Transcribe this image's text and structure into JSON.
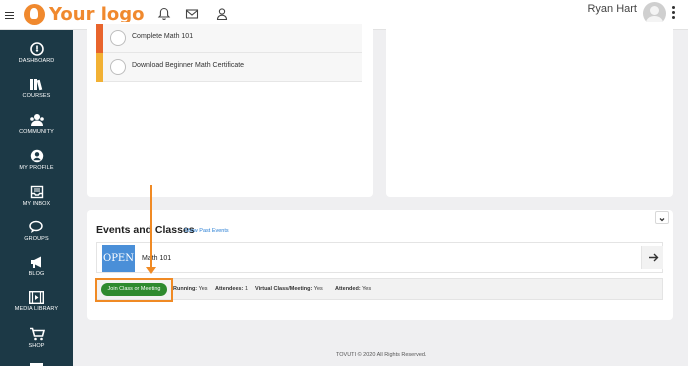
{
  "app": {
    "logo_text_1": "Your",
    "logo_text_2": "logo",
    "brand_color": "#f0892e"
  },
  "header": {
    "icons": [
      "bell-icon",
      "mail-icon",
      "user-icon"
    ],
    "user_name": "Ryan Hart"
  },
  "sidebar": {
    "items": [
      {
        "label": "DASHBOARD",
        "icon": "dashboard-icon"
      },
      {
        "label": "COURSES",
        "icon": "books-icon"
      },
      {
        "label": "COMMUNITY",
        "icon": "community-icon"
      },
      {
        "label": "MY PROFILE",
        "icon": "profile-icon"
      },
      {
        "label": "MY INBOX",
        "icon": "inbox-icon"
      },
      {
        "label": "GROUPS",
        "icon": "groups-icon"
      },
      {
        "label": "BLOG",
        "icon": "megaphone-icon"
      },
      {
        "label": "MEDIA LIBRARY",
        "icon": "film-icon"
      },
      {
        "label": "SHOP",
        "icon": "cart-icon"
      }
    ],
    "background": "#1c3946"
  },
  "tasks": [
    {
      "label": "Complete Math 101",
      "color": "#e8642c"
    },
    {
      "label": "Download Beginner Math Certificate",
      "color": "#f2b134"
    }
  ],
  "events": {
    "title": "Events and Classes",
    "past_link": "Show Past Events",
    "class": {
      "badge": "OPEN",
      "name": "Math 101"
    },
    "join_button": "Join Class or Meeting",
    "meta": [
      {
        "label": "Running:",
        "value": "Yes"
      },
      {
        "label": "Attendees:",
        "value": "1"
      },
      {
        "label": "Virtual Class/Meeting:",
        "value": "Yes"
      },
      {
        "label": "Attended:",
        "value": "Yes"
      }
    ]
  },
  "annotation_color": "#f08a24",
  "footer": {
    "text": "TOVUTI © 2020 All Rights Reserved."
  }
}
